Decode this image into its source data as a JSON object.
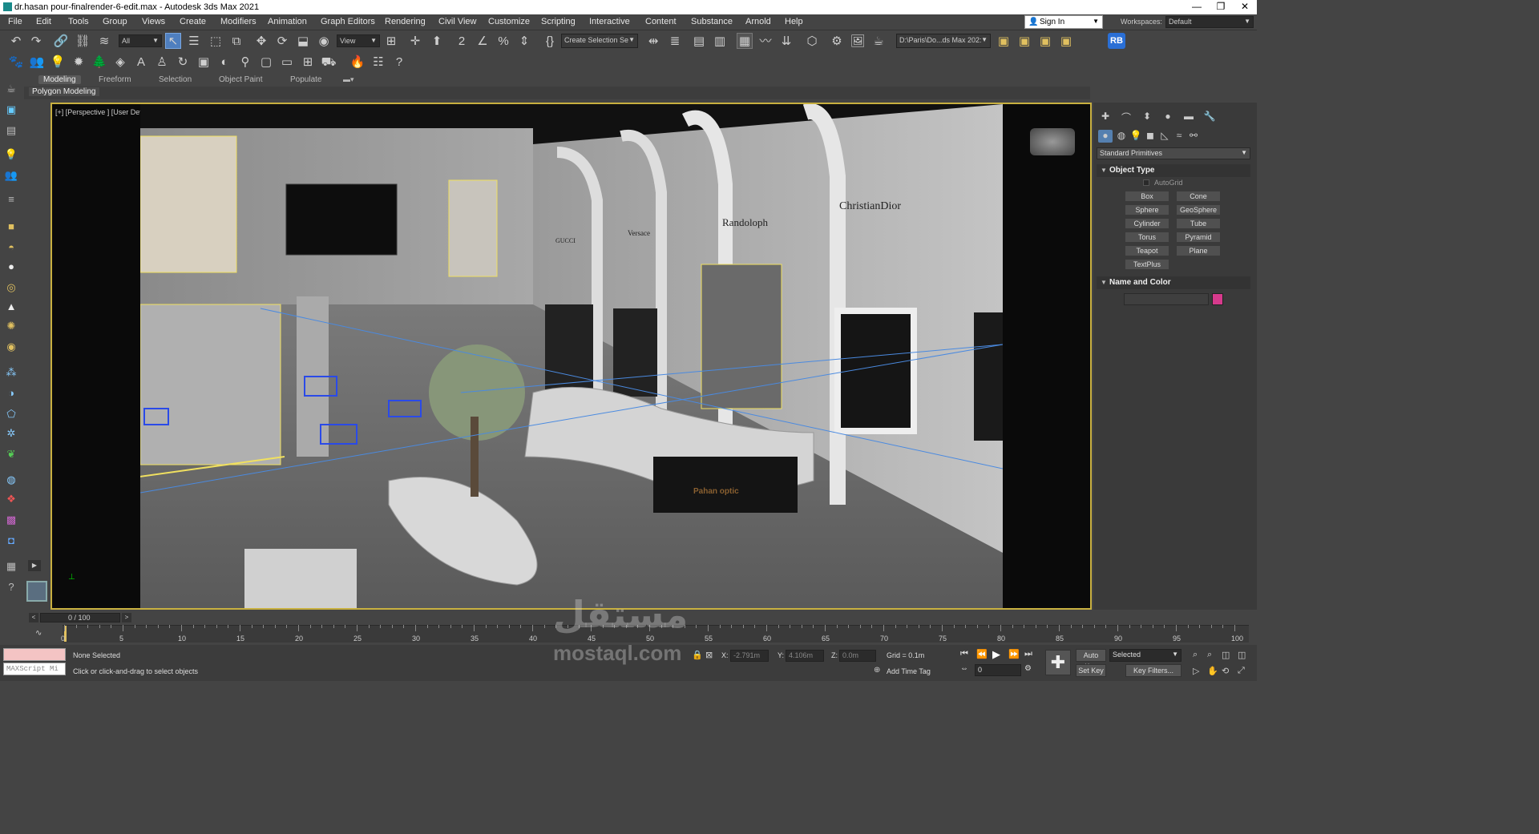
{
  "window": {
    "title": "dr.hasan pour-finalrender-6-edit.max - Autodesk 3ds Max 2021",
    "minimize": "—",
    "maximize": "❐",
    "close": "✕"
  },
  "menu": [
    "File",
    "Edit",
    "Tools",
    "Group",
    "Views",
    "Create",
    "Modifiers",
    "Animation",
    "Graph Editors",
    "Rendering",
    "Civil View",
    "Customize",
    "Scripting",
    "Interactive",
    "Content",
    "Substance",
    "Arnold",
    "Help"
  ],
  "account": {
    "sign_in": "Sign In",
    "workspaces_label": "Workspaces:",
    "workspace_value": "Default"
  },
  "toolbar": {
    "filter_value": "All",
    "refcoord_value": "View",
    "selection_set_placeholder": "Create Selection Se",
    "path_value": "D:\\Paris\\Do...ds Max 202:",
    "rb_badge": "RB"
  },
  "ribbon": {
    "tabs": [
      "Modeling",
      "Freeform",
      "Selection",
      "Object Paint",
      "Populate"
    ],
    "active_tab": "Modeling",
    "sub_label": "Polygon Modeling"
  },
  "viewport": {
    "label": "[+] [Perspective ] [User Defined ] [Default Shading ]",
    "brand_gucci": "GUCCI",
    "brand_versace": "Versace",
    "brand_randoloph": "Randoloph",
    "brand_dior": "ChristianDior",
    "desk_sign": "Pahan optic"
  },
  "command_panel": {
    "category_value": "Standard Primitives",
    "object_type_title": "Object Type",
    "autogrid_label": "AutoGrid",
    "primitives": [
      "Box",
      "Cone",
      "Sphere",
      "GeoSphere",
      "Cylinder",
      "Tube",
      "Torus",
      "Pyramid",
      "Teapot",
      "Plane",
      "TextPlus"
    ],
    "name_color_title": "Name and Color",
    "object_color": "#d63a8c"
  },
  "timeline": {
    "frame_display": "0 / 100",
    "ticks": [
      "0",
      "5",
      "10",
      "15",
      "20",
      "25",
      "30",
      "35",
      "40",
      "45",
      "50",
      "55",
      "60",
      "65",
      "70",
      "75",
      "80",
      "85",
      "90",
      "95",
      "100"
    ]
  },
  "status": {
    "maxscript_placeholder": "MAXScript Mi",
    "selection_status": "None Selected",
    "prompt": "Click or click-and-drag to select objects",
    "x_label": "X:",
    "x_value": "-2.791m",
    "y_label": "Y:",
    "y_value": "4.106m",
    "z_label": "Z:",
    "z_value": "0.0m",
    "grid": "Grid = 0.1m",
    "add_time_tag": "Add Time Tag",
    "auto_key": "Auto Key",
    "set_key": "Set Key",
    "key_mode_value": "Selected",
    "key_filters": "Key Filters...",
    "frame_value": "0"
  },
  "watermark": {
    "arabic": "مستقل",
    "latin": "mostaql.com"
  }
}
